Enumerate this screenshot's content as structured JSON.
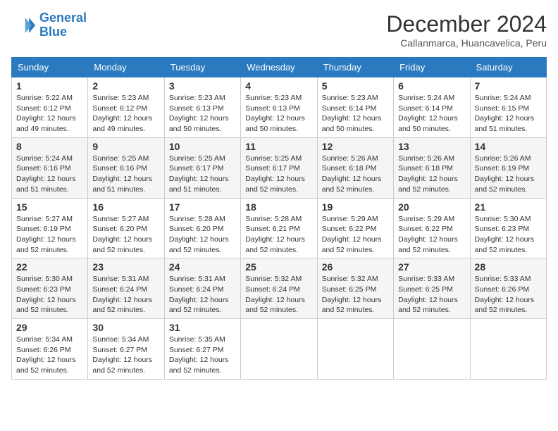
{
  "logo": {
    "line1": "General",
    "line2": "Blue"
  },
  "header": {
    "month": "December 2024",
    "location": "Callanmarca, Huancavelica, Peru"
  },
  "weekdays": [
    "Sunday",
    "Monday",
    "Tuesday",
    "Wednesday",
    "Thursday",
    "Friday",
    "Saturday"
  ],
  "weeks": [
    [
      {
        "day": "1",
        "info": "Sunrise: 5:22 AM\nSunset: 6:12 PM\nDaylight: 12 hours\nand 49 minutes."
      },
      {
        "day": "2",
        "info": "Sunrise: 5:23 AM\nSunset: 6:12 PM\nDaylight: 12 hours\nand 49 minutes."
      },
      {
        "day": "3",
        "info": "Sunrise: 5:23 AM\nSunset: 6:13 PM\nDaylight: 12 hours\nand 50 minutes."
      },
      {
        "day": "4",
        "info": "Sunrise: 5:23 AM\nSunset: 6:13 PM\nDaylight: 12 hours\nand 50 minutes."
      },
      {
        "day": "5",
        "info": "Sunrise: 5:23 AM\nSunset: 6:14 PM\nDaylight: 12 hours\nand 50 minutes."
      },
      {
        "day": "6",
        "info": "Sunrise: 5:24 AM\nSunset: 6:14 PM\nDaylight: 12 hours\nand 50 minutes."
      },
      {
        "day": "7",
        "info": "Sunrise: 5:24 AM\nSunset: 6:15 PM\nDaylight: 12 hours\nand 51 minutes."
      }
    ],
    [
      {
        "day": "8",
        "info": "Sunrise: 5:24 AM\nSunset: 6:16 PM\nDaylight: 12 hours\nand 51 minutes."
      },
      {
        "day": "9",
        "info": "Sunrise: 5:25 AM\nSunset: 6:16 PM\nDaylight: 12 hours\nand 51 minutes."
      },
      {
        "day": "10",
        "info": "Sunrise: 5:25 AM\nSunset: 6:17 PM\nDaylight: 12 hours\nand 51 minutes."
      },
      {
        "day": "11",
        "info": "Sunrise: 5:25 AM\nSunset: 6:17 PM\nDaylight: 12 hours\nand 52 minutes."
      },
      {
        "day": "12",
        "info": "Sunrise: 5:26 AM\nSunset: 6:18 PM\nDaylight: 12 hours\nand 52 minutes."
      },
      {
        "day": "13",
        "info": "Sunrise: 5:26 AM\nSunset: 6:18 PM\nDaylight: 12 hours\nand 52 minutes."
      },
      {
        "day": "14",
        "info": "Sunrise: 5:26 AM\nSunset: 6:19 PM\nDaylight: 12 hours\nand 52 minutes."
      }
    ],
    [
      {
        "day": "15",
        "info": "Sunrise: 5:27 AM\nSunset: 6:19 PM\nDaylight: 12 hours\nand 52 minutes."
      },
      {
        "day": "16",
        "info": "Sunrise: 5:27 AM\nSunset: 6:20 PM\nDaylight: 12 hours\nand 52 minutes."
      },
      {
        "day": "17",
        "info": "Sunrise: 5:28 AM\nSunset: 6:20 PM\nDaylight: 12 hours\nand 52 minutes."
      },
      {
        "day": "18",
        "info": "Sunrise: 5:28 AM\nSunset: 6:21 PM\nDaylight: 12 hours\nand 52 minutes."
      },
      {
        "day": "19",
        "info": "Sunrise: 5:29 AM\nSunset: 6:22 PM\nDaylight: 12 hours\nand 52 minutes."
      },
      {
        "day": "20",
        "info": "Sunrise: 5:29 AM\nSunset: 6:22 PM\nDaylight: 12 hours\nand 52 minutes."
      },
      {
        "day": "21",
        "info": "Sunrise: 5:30 AM\nSunset: 6:23 PM\nDaylight: 12 hours\nand 52 minutes."
      }
    ],
    [
      {
        "day": "22",
        "info": "Sunrise: 5:30 AM\nSunset: 6:23 PM\nDaylight: 12 hours\nand 52 minutes."
      },
      {
        "day": "23",
        "info": "Sunrise: 5:31 AM\nSunset: 6:24 PM\nDaylight: 12 hours\nand 52 minutes."
      },
      {
        "day": "24",
        "info": "Sunrise: 5:31 AM\nSunset: 6:24 PM\nDaylight: 12 hours\nand 52 minutes."
      },
      {
        "day": "25",
        "info": "Sunrise: 5:32 AM\nSunset: 6:24 PM\nDaylight: 12 hours\nand 52 minutes."
      },
      {
        "day": "26",
        "info": "Sunrise: 5:32 AM\nSunset: 6:25 PM\nDaylight: 12 hours\nand 52 minutes."
      },
      {
        "day": "27",
        "info": "Sunrise: 5:33 AM\nSunset: 6:25 PM\nDaylight: 12 hours\nand 52 minutes."
      },
      {
        "day": "28",
        "info": "Sunrise: 5:33 AM\nSunset: 6:26 PM\nDaylight: 12 hours\nand 52 minutes."
      }
    ],
    [
      {
        "day": "29",
        "info": "Sunrise: 5:34 AM\nSunset: 6:26 PM\nDaylight: 12 hours\nand 52 minutes."
      },
      {
        "day": "30",
        "info": "Sunrise: 5:34 AM\nSunset: 6:27 PM\nDaylight: 12 hours\nand 52 minutes."
      },
      {
        "day": "31",
        "info": "Sunrise: 5:35 AM\nSunset: 6:27 PM\nDaylight: 12 hours\nand 52 minutes."
      },
      null,
      null,
      null,
      null
    ]
  ]
}
